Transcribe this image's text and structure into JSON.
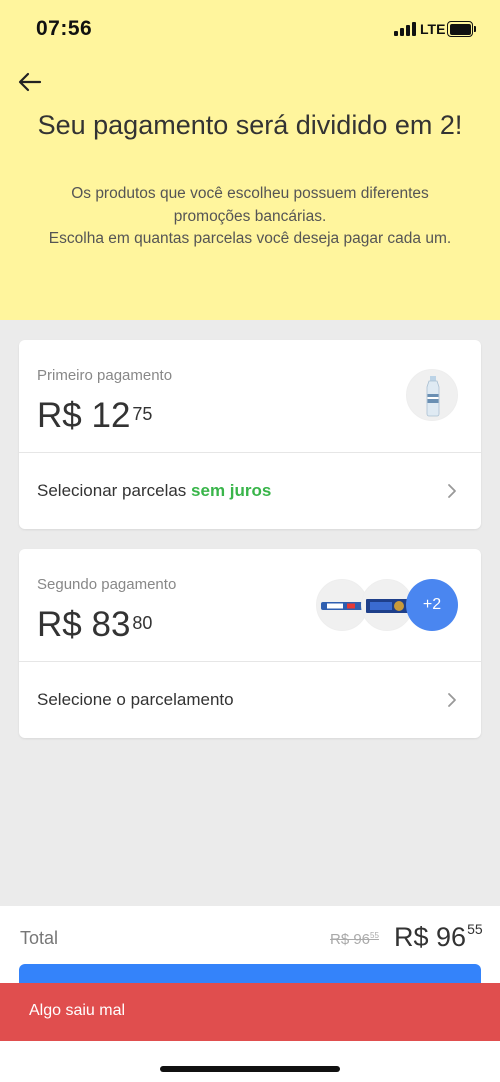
{
  "status_bar": {
    "time": "07:56",
    "network": "LTE"
  },
  "header": {
    "title": "Seu pagamento será dividido em 2!",
    "subtitle_line1": "Os produtos que você escolheu possuem diferentes promoções bancárias.",
    "subtitle_line2": "Escolha em quantas parcelas você deseja pagar cada um."
  },
  "payments": [
    {
      "label": "Primeiro pagamento",
      "currency": "R$",
      "amount_int": "12",
      "amount_cents": "75",
      "action_text": "Selecionar parcelas",
      "action_highlight": "sem juros",
      "items": [
        "water-bottle"
      ]
    },
    {
      "label": "Segundo pagamento",
      "currency": "R$",
      "amount_int": "83",
      "amount_cents": "80",
      "action_text": "Selecione o parcelamento",
      "items": [
        "candy-bar",
        "snack-pack"
      ],
      "more_items": "+2"
    }
  ],
  "footer": {
    "total_label": "Total",
    "old_price_int": "R$ 96",
    "old_price_cents": "55",
    "new_price_int": "R$ 96",
    "new_price_cents": "55"
  },
  "toast": {
    "message": "Algo saiu mal"
  },
  "colors": {
    "header_bg": "#fff59d",
    "accent_green": "#39b54a",
    "accent_blue": "#3483fa",
    "error_red": "#e04e4e"
  }
}
